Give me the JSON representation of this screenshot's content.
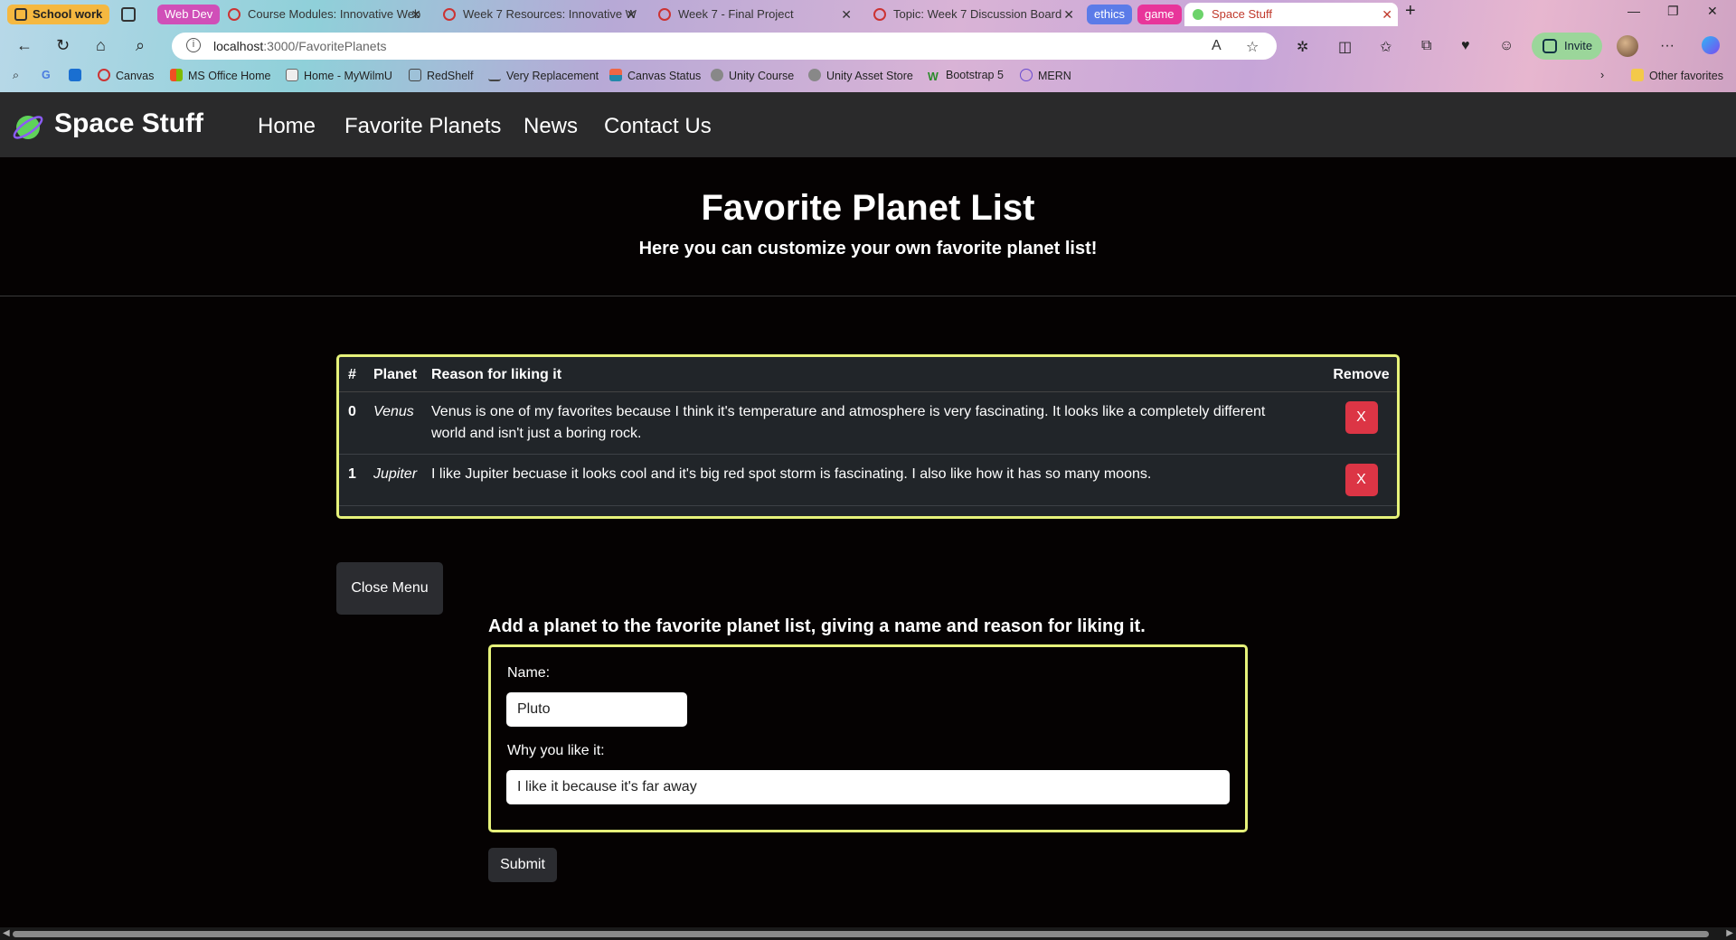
{
  "browser": {
    "tab_groups": [
      {
        "label": "School work",
        "color": "#f5b840"
      },
      {
        "label": "Web Dev",
        "color": "#d04fb8"
      },
      {
        "label": "ethics",
        "color": "#5b7be8"
      },
      {
        "label": "game",
        "color": "#e8359a"
      }
    ],
    "tabs": [
      {
        "title": "Course Modules: Innovative Web"
      },
      {
        "title": "Week 7 Resources: Innovative W"
      },
      {
        "title": "Week 7 - Final Project"
      },
      {
        "title": "Topic: Week 7 Discussion Board"
      },
      {
        "title": "Space Stuff"
      }
    ],
    "url_host": "localhost",
    "url_path": ":3000/FavoritePlanets",
    "invite_label": "Invite",
    "bookmarks": [
      {
        "label": "Canvas"
      },
      {
        "label": "MS Office Home"
      },
      {
        "label": "Home - MyWilmU"
      },
      {
        "label": "RedShelf"
      },
      {
        "label": "Very Replacement"
      },
      {
        "label": "Canvas Status"
      },
      {
        "label": "Unity Course"
      },
      {
        "label": "Unity Asset Store"
      },
      {
        "label": "Bootstrap 5"
      },
      {
        "label": "MERN"
      }
    ],
    "other_favorites": "Other favorites"
  },
  "site": {
    "brand": "Space Stuff",
    "nav": [
      "Home",
      "Favorite Planets",
      "News",
      "Contact Us"
    ]
  },
  "hero": {
    "title": "Favorite Planet List",
    "subtitle": "Here you can customize your own favorite planet list!"
  },
  "table": {
    "headers": {
      "num": "#",
      "planet": "Planet",
      "reason": "Reason for liking it",
      "remove": "Remove"
    },
    "rows": [
      {
        "num": "0",
        "planet": "Venus",
        "reason": "Venus is one of my favorites because I think it's temperature and atmosphere is very fascinating. It looks like a completely different world and isn't just a boring rock.",
        "remove": "X"
      },
      {
        "num": "1",
        "planet": "Jupiter",
        "reason": "I like Jupiter becuase it looks cool and it's big red spot storm is fascinating. I also like how it has so many moons.",
        "remove": "X"
      }
    ]
  },
  "close_menu_label": "Close Menu",
  "form": {
    "heading": "Add a planet to the favorite planet list, giving a name and reason for liking it.",
    "name_label": "Name:",
    "name_value": "Pluto",
    "reason_label": "Why you like it:",
    "reason_value": "I like it because it's far away",
    "submit_label": "Submit"
  },
  "colors": {
    "accent_border": "#e6f27a",
    "remove_button": "#dc3545",
    "nav_background": "#2a2a2b"
  }
}
